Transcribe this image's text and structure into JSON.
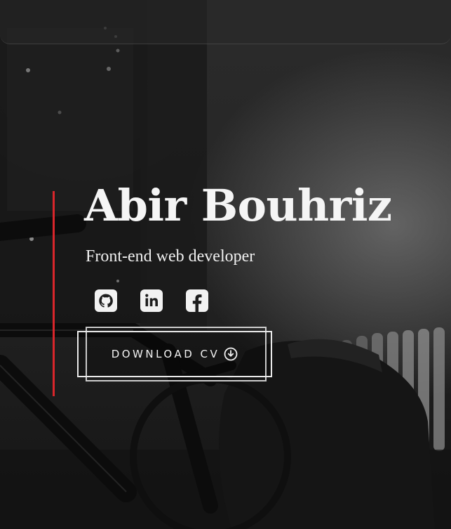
{
  "hero": {
    "name": "Abir Bouhriz",
    "subtitle": "Front-end web developer",
    "socials": [
      {
        "icon": "github-icon"
      },
      {
        "icon": "linkedin-icon"
      },
      {
        "icon": "facebook-icon"
      }
    ],
    "cv_button": {
      "label": "DOWNLOAD CV",
      "icon": "download-circle-icon"
    }
  },
  "colors": {
    "accent": "#d9262b",
    "text": "#f5f5f5",
    "background": "#1f1f1f"
  }
}
